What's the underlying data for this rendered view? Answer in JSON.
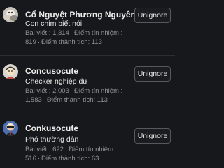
{
  "ignored_users": [
    {
      "username": "Cổ Nguyệt Phương Nguyên",
      "title": "Con chim biết nói",
      "stats_line1": "Bài viết : 1,314",
      "stats_line2": "Điểm tín nhiệm : 819",
      "stats_line3": "Điểm thành",
      "stats_line4": "tích: 113",
      "button_label": "Unignore"
    },
    {
      "username": "Concusocute",
      "title": "Checker nghiệp dư",
      "stats_line1": "Bài viết : 2,003",
      "stats_line2": "Điểm tín nhiệm : 1,583",
      "stats_line3": "Điểm thành",
      "stats_line4": "tích: 113",
      "button_label": "Unignore"
    },
    {
      "username": "Conkusocute",
      "title": "Phó thường dân",
      "stats_line1": "Bài viết : 622",
      "stats_line2": "Điểm tín nhiệm : 516",
      "stats_line3": "Điểm thành",
      "stats_line4": "tích: 63",
      "button_label": "Unignore"
    }
  ],
  "separator": "·",
  "colors": {
    "background": "#17181b",
    "text_primary": "#ededed",
    "text_muted": "#8e9197",
    "button_border": "#55585e",
    "divider": "#2c2e33"
  }
}
